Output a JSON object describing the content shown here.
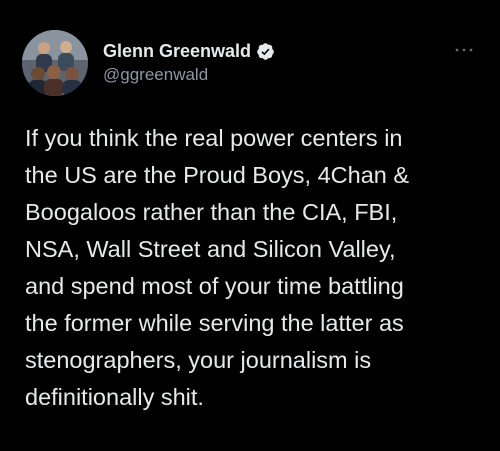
{
  "author": {
    "display_name": "Glenn Greenwald",
    "handle": "@ggreenwald",
    "verified": true,
    "avatar_icon": "profile-photo"
  },
  "actions": {
    "more_icon": "more-horizontal-icon"
  },
  "tweet": {
    "lines": [
      "If you think the real power centers in",
      "the US are the Proud Boys, 4Chan &",
      "Boogaloos rather than the CIA, FBI,",
      "NSA, Wall Street and Silicon Valley,",
      "and spend most of your time battling",
      "the former while serving the latter as",
      "stenographers, your journalism is",
      "definitionally shit."
    ]
  },
  "colors": {
    "background": "#000000",
    "text": "#e7e9ea",
    "secondary_text": "#8b98a5",
    "verified_badge": "#e7e9ea"
  }
}
